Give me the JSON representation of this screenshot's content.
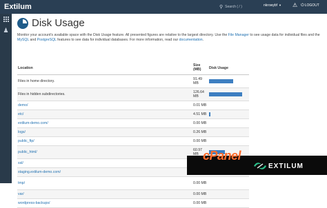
{
  "topbar": {
    "brand": "Extilum",
    "search_placeholder": "Search ( / )",
    "username": "nkrowybf",
    "logout_label": "LOGOUT"
  },
  "page": {
    "title": "Disk Usage",
    "description": {
      "part1": "Monitor your account's available space with the Disk Usage feature. All presented figures are relative to the largest directory. Use the ",
      "link_file_manager": "File Manager",
      "part2": " to see usage data for individual files and the ",
      "link_mysql": "MySQL",
      "part3": " and ",
      "link_postgresql": "PostgreSQL",
      "part4": " features to see data for individual databases. For more information, read our ",
      "link_documentation": "documentation",
      "part5": "."
    }
  },
  "table": {
    "headers": {
      "location": "Location",
      "size": "Size (MB)",
      "usage": "Disk Usage"
    },
    "rows": [
      {
        "location": "Files in home directory.",
        "size": "91.49 MB",
        "usage_fraction": 0.72,
        "link": false,
        "height": 18
      },
      {
        "location": "Files in hidden subdirectories.",
        "size": "126.64 MB",
        "usage_fraction": 1.0,
        "link": false,
        "height": 18
      },
      {
        "location": "demo/",
        "size": "0.01 MB",
        "usage_fraction": 0.0,
        "link": true,
        "height": 12
      },
      {
        "location": "etc/",
        "size": "4.51 MB",
        "usage_fraction": 0.036,
        "link": true,
        "height": 12
      },
      {
        "location": "extilum-demo.com/",
        "size": "0.00 MB",
        "usage_fraction": 0.0,
        "link": true,
        "height": 12
      },
      {
        "location": "logs/",
        "size": "0.26 MB",
        "usage_fraction": 0.0,
        "link": true,
        "height": 12
      },
      {
        "location": "public_ftp/",
        "size": "0.00 MB",
        "usage_fraction": 0.0,
        "link": true,
        "height": 12
      },
      {
        "location": "public_html/",
        "size": "60.97 MB",
        "usage_fraction": 0.48,
        "link": true,
        "height": 18
      },
      {
        "location": "ssl/",
        "size": "0.12 MB",
        "usage_fraction": 0.0,
        "link": true,
        "height": 12
      },
      {
        "location": "staging.extilum-demo.com/",
        "size": "0.00 MB",
        "usage_fraction": 0.0,
        "link": true,
        "height": 12
      },
      {
        "location": "tmp/",
        "size": "0.00 MB",
        "usage_fraction": 0.0,
        "link": true,
        "height": 18
      },
      {
        "location": "var/",
        "size": "0.00 MB",
        "usage_fraction": 0.0,
        "link": true,
        "height": 12
      },
      {
        "location": "wordpress-backups/",
        "size": "0.00 MB",
        "usage_fraction": 0.0,
        "link": true,
        "height": 12
      }
    ]
  },
  "watermark": {
    "cpanel_logo": "cPanel",
    "brand": "EXTILUM"
  },
  "colors": {
    "topbar": "#2a3f54",
    "rail": "#293a4a",
    "link": "#1e6fb0",
    "bar": "#3d7fc1",
    "cpanel_orange": "#ff6c2c"
  },
  "icons": {
    "rail": [
      "apps-grid-icon",
      "users-icon"
    ],
    "topbar": [
      "search-icon",
      "bell-icon",
      "power-icon"
    ],
    "title": "pie-chart-icon"
  }
}
